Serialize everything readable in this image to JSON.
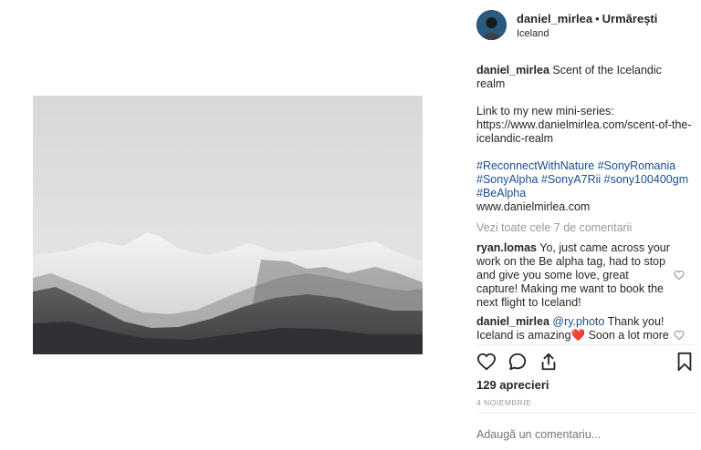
{
  "post": {
    "username": "daniel_mirlea",
    "separator": "•",
    "follow_label": "Urmărești",
    "location": "Iceland"
  },
  "caption": {
    "author": "daniel_mirlea",
    "line1": "Scent of the Icelandic realm",
    "line2": "Link to my new mini-series:",
    "line3": "https://www.danielmirlea.com/scent-of-the-icelandic-realm",
    "hashtags": "#ReconnectWithNature #SonyRomania #SonyAlpha #SonyA7Rii #sony100400gm #BeAlpha",
    "website": "www.danielmirlea.com"
  },
  "view_all": "Vezi toate cele 7 de comentarii",
  "comments": [
    {
      "author": "ryan.lomas",
      "text": "Yo, just came across your work on the Be alpha tag, had to stop and give you some love, great capture! Making me want to book the next flight to Iceland!"
    },
    {
      "author": "daniel_mirlea",
      "mention": "@ry.photo",
      "text": "Thank you! Iceland is amazing",
      "emoji": "❤️",
      "text2": " Soon a lot more"
    }
  ],
  "likes": "129 aprecieri",
  "date": "4 NOIEMBRIE",
  "add_comment_placeholder": "Adaugă un comentariu...",
  "icons": {
    "like": "heart-icon",
    "comment": "comment-icon",
    "share": "share-icon",
    "save": "bookmark-icon"
  }
}
